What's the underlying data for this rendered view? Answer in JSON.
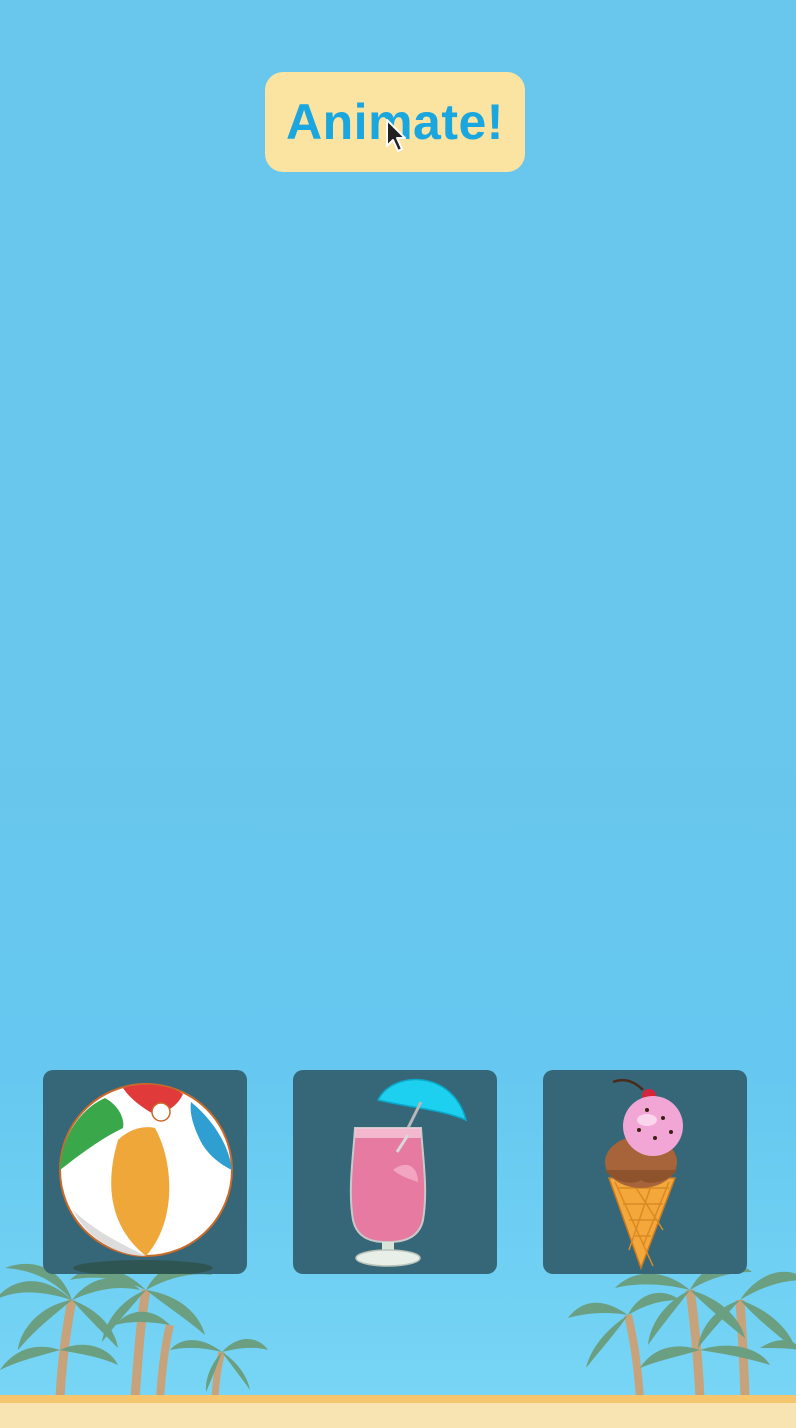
{
  "button": {
    "label": "Animate!"
  },
  "items": [
    {
      "icon": "beach-ball-icon"
    },
    {
      "icon": "tropical-drink-icon"
    },
    {
      "icon": "ice-cream-cone-icon"
    }
  ],
  "colors": {
    "sky": "#69c6ec",
    "button_bg": "#fbe3a1",
    "button_text": "#1aa6de",
    "tile_bg": "#366779",
    "sand": "#f7e4b2",
    "palm_leaves": "#6a9f82"
  }
}
